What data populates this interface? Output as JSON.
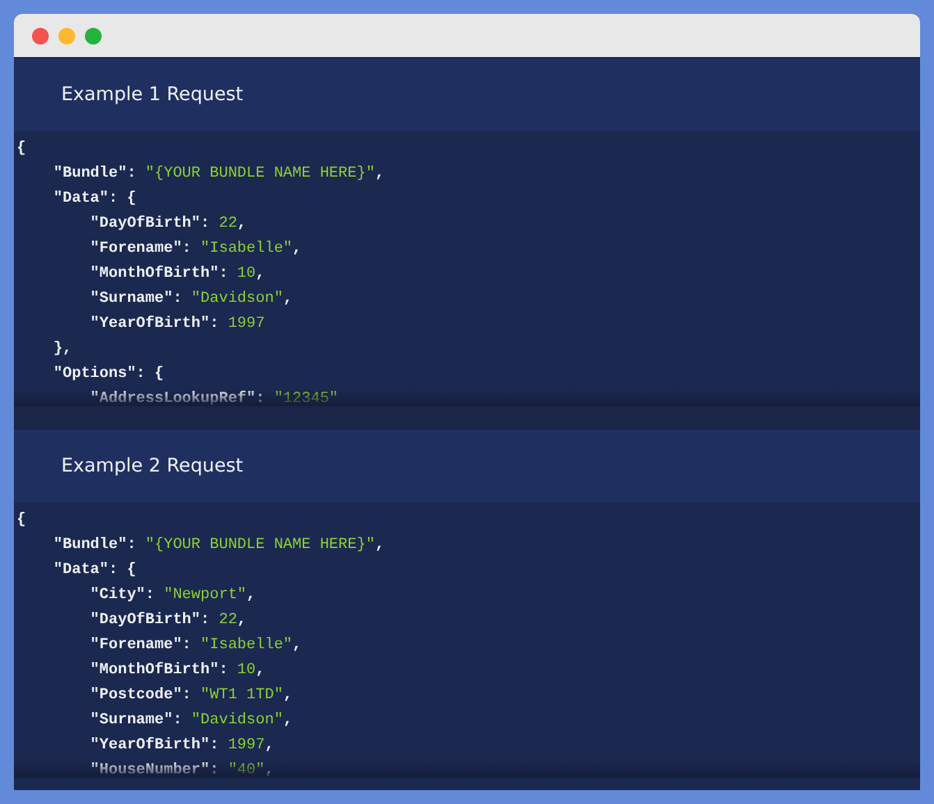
{
  "window": {
    "controls": [
      {
        "kind": "close"
      },
      {
        "kind": "minimize"
      },
      {
        "kind": "zoom"
      }
    ]
  },
  "examples": [
    {
      "title": "Example 1 Request",
      "lines": [
        {
          "tokens": [
            {
              "kind": "punct",
              "text": "{"
            }
          ],
          "children": [
            {
              "tokens": [
                {
                  "kind": "key",
                  "text": "\"Bundle\": "
                },
                {
                  "kind": "value",
                  "text": "\"{YOUR BUNDLE NAME HERE}\""
                },
                {
                  "kind": "punct",
                  "text": ","
                }
              ]
            },
            {
              "tokens": [
                {
                  "kind": "key",
                  "text": "\"Data\": {"
                }
              ],
              "children": [
                {
                  "tokens": [
                    {
                      "kind": "key",
                      "text": "\"DayOfBirth\": "
                    },
                    {
                      "kind": "value",
                      "text": "22"
                    },
                    {
                      "kind": "punct",
                      "text": ","
                    }
                  ]
                },
                {
                  "tokens": [
                    {
                      "kind": "key",
                      "text": "\"Forename\": "
                    },
                    {
                      "kind": "value",
                      "text": "\"Isabelle\""
                    },
                    {
                      "kind": "punct",
                      "text": ","
                    }
                  ]
                },
                {
                  "tokens": [
                    {
                      "kind": "key",
                      "text": "\"MonthOfBirth\": "
                    },
                    {
                      "kind": "value",
                      "text": "10"
                    },
                    {
                      "kind": "punct",
                      "text": ","
                    }
                  ]
                },
                {
                  "tokens": [
                    {
                      "kind": "key",
                      "text": "\"Surname\": "
                    },
                    {
                      "kind": "value",
                      "text": "\"Davidson\""
                    },
                    {
                      "kind": "punct",
                      "text": ","
                    }
                  ]
                },
                {
                  "tokens": [
                    {
                      "kind": "key",
                      "text": "\"YearOfBirth\": "
                    },
                    {
                      "kind": "value",
                      "text": "1997"
                    }
                  ]
                }
              ]
            },
            {
              "tokens": [
                {
                  "kind": "punct",
                  "text": "},"
                }
              ]
            },
            {
              "tokens": [
                {
                  "kind": "key",
                  "text": "\"Options\": {"
                }
              ],
              "children": [
                {
                  "tokens": [
                    {
                      "kind": "key",
                      "text": "\"AddressLookupRef\": "
                    },
                    {
                      "kind": "value",
                      "text": "\"12345\""
                    }
                  ]
                }
              ]
            }
          ]
        }
      ]
    },
    {
      "title": "Example 2 Request",
      "lines": [
        {
          "tokens": [
            {
              "kind": "punct",
              "text": "{"
            }
          ],
          "children": [
            {
              "tokens": [
                {
                  "kind": "key",
                  "text": "\"Bundle\": "
                },
                {
                  "kind": "value",
                  "text": "\"{YOUR BUNDLE NAME HERE}\""
                },
                {
                  "kind": "punct",
                  "text": ","
                }
              ]
            },
            {
              "tokens": [
                {
                  "kind": "key",
                  "text": "\"Data\": {"
                }
              ],
              "children": [
                {
                  "tokens": [
                    {
                      "kind": "key",
                      "text": "\"City\": "
                    },
                    {
                      "kind": "value",
                      "text": "\"Newport\""
                    },
                    {
                      "kind": "punct",
                      "text": ","
                    }
                  ]
                },
                {
                  "tokens": [
                    {
                      "kind": "key",
                      "text": "\"DayOfBirth\": "
                    },
                    {
                      "kind": "value",
                      "text": "22"
                    },
                    {
                      "kind": "punct",
                      "text": ","
                    }
                  ]
                },
                {
                  "tokens": [
                    {
                      "kind": "key",
                      "text": "\"Forename\": "
                    },
                    {
                      "kind": "value",
                      "text": "\"Isabelle\""
                    },
                    {
                      "kind": "punct",
                      "text": ","
                    }
                  ]
                },
                {
                  "tokens": [
                    {
                      "kind": "key",
                      "text": "\"MonthOfBirth\": "
                    },
                    {
                      "kind": "value",
                      "text": "10"
                    },
                    {
                      "kind": "punct",
                      "text": ","
                    }
                  ]
                },
                {
                  "tokens": [
                    {
                      "kind": "key",
                      "text": "\"Postcode\": "
                    },
                    {
                      "kind": "value",
                      "text": "\"WT1 1TD\""
                    },
                    {
                      "kind": "punct",
                      "text": ","
                    }
                  ]
                },
                {
                  "tokens": [
                    {
                      "kind": "key",
                      "text": "\"Surname\": "
                    },
                    {
                      "kind": "value",
                      "text": "\"Davidson\""
                    },
                    {
                      "kind": "punct",
                      "text": ","
                    }
                  ]
                },
                {
                  "tokens": [
                    {
                      "kind": "key",
                      "text": "\"YearOfBirth\": "
                    },
                    {
                      "kind": "value",
                      "text": "1997"
                    },
                    {
                      "kind": "punct",
                      "text": ","
                    }
                  ]
                },
                {
                  "tokens": [
                    {
                      "kind": "key",
                      "text": "\"HouseNumber\": "
                    },
                    {
                      "kind": "value",
                      "text": "\"40\""
                    },
                    {
                      "kind": "punct",
                      "text": ","
                    }
                  ]
                }
              ]
            }
          ]
        }
      ]
    }
  ]
}
